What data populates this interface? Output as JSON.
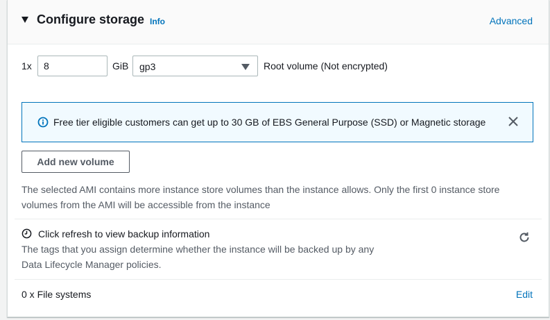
{
  "header": {
    "title": "Configure storage",
    "info_label": "Info",
    "advanced_label": "Advanced"
  },
  "volume": {
    "multiplier": "1x",
    "size_value": "8",
    "unit": "GiB",
    "type_selected": "gp3",
    "description": "Root volume  (Not encrypted)"
  },
  "alert": {
    "text": "Free tier eligible customers can get up to 30 GB of EBS General Purpose (SSD) or Magnetic storage",
    "icon": "info-circle-icon",
    "close_icon": "close-icon"
  },
  "add_volume_label": "Add new volume",
  "ami_note": "The selected AMI contains more instance store volumes than the instance allows. Only the first 0 instance store volumes from the AMI will be accessible from the instance",
  "backup": {
    "title": "Click refresh to view backup information",
    "description_line1": "The tags that you assign determine whether the instance will be backed up by any",
    "description_line2": "Data Lifecycle Manager policies.",
    "icon": "clock-icon",
    "refresh_icon": "refresh-icon"
  },
  "file_systems": {
    "text": "0 x File systems",
    "edit_label": "Edit"
  },
  "colors": {
    "link": "#0073bb",
    "alert_bg": "#f1faff",
    "alert_border": "#0073bb",
    "text": "#16191f",
    "secondary_text": "#545b64"
  }
}
